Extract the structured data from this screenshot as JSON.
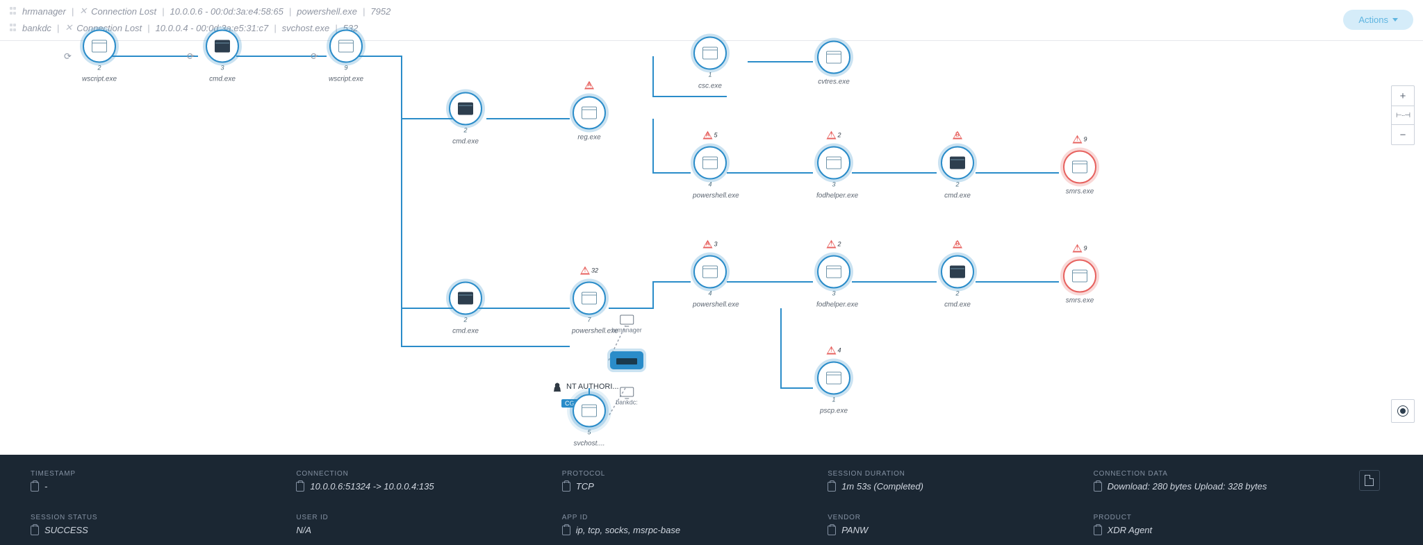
{
  "breadcrumbs": [
    {
      "host": "hrmanager",
      "status": "Connection Lost",
      "detail": "10.0.0.6 - 00:0d:3a:e4:58:65",
      "proc": "powershell.exe",
      "pid": "7952"
    },
    {
      "host": "bankdc",
      "status": "Connection Lost",
      "detail": "10.0.0.4 - 00:0d:3a:e5:31:c7",
      "proc": "svchost.exe",
      "pid": "532"
    }
  ],
  "actions_label": "Actions",
  "nodes": {
    "wscript1": {
      "label": "wscript.exe",
      "count": "2"
    },
    "cmd_top": {
      "label": "cmd.exe",
      "count": "3"
    },
    "wscript2": {
      "label": "wscript.exe",
      "count": "9"
    },
    "cmd_mid": {
      "label": "cmd.exe",
      "count": "2"
    },
    "reg": {
      "label": "reg.exe",
      "count": "",
      "warn": "A",
      "warn_n": ""
    },
    "csc": {
      "label": "csc.exe",
      "count": "1"
    },
    "cvtres": {
      "label": "cvtres.exe",
      "count": ""
    },
    "ps1": {
      "label": "powershell.exe",
      "count": "4",
      "warn": "A",
      "warn_n": "5"
    },
    "fod1": {
      "label": "fodhelper.exe",
      "count": "3",
      "warn": "!",
      "warn_n": "2"
    },
    "cmd_r1": {
      "label": "cmd.exe",
      "count": "2",
      "warn": "B",
      "warn_n": ""
    },
    "smrs1": {
      "label": "smrs.exe",
      "count": "",
      "warn": "!",
      "warn_n": "9"
    },
    "ps2": {
      "label": "powershell.exe",
      "count": "4",
      "warn": "A",
      "warn_n": "3"
    },
    "fod2": {
      "label": "fodhelper.exe",
      "count": "3",
      "warn": "!",
      "warn_n": "2"
    },
    "cmd_r2": {
      "label": "cmd.exe",
      "count": "2",
      "warn": "B",
      "warn_n": ""
    },
    "smrs2": {
      "label": "smrs.exe",
      "count": "",
      "warn": "!",
      "warn_n": "9"
    },
    "cmd_low": {
      "label": "cmd.exe",
      "count": "2"
    },
    "ps3": {
      "label": "powershell.exe",
      "count": "7",
      "warn": "!",
      "warn_n": "32"
    },
    "svchost": {
      "label": "svchost....",
      "count": "5"
    },
    "pscp": {
      "label": "pscp.exe",
      "count": "1",
      "warn": "!",
      "warn_n": "4"
    }
  },
  "mini": {
    "hrmanager": "hrmanager",
    "bankdc": "bankdc:"
  },
  "user_label": "NT AUTHORI...",
  "tag": "CGO",
  "bottom": {
    "timestamp_lab": "TIMESTAMP",
    "timestamp": "-",
    "connection_lab": "CONNECTION",
    "connection": "10.0.0.6:51324 -> 10.0.0.4:135",
    "protocol_lab": "PROTOCOL",
    "protocol": "TCP",
    "duration_lab": "SESSION DURATION",
    "duration": "1m 53s (Completed)",
    "conndata_lab": "CONNECTION DATA",
    "conndata": "Download: 280 bytes Upload: 328 bytes",
    "status_lab": "SESSION STATUS",
    "status": "SUCCESS",
    "user_lab": "USER ID",
    "user": "N/A",
    "appid_lab": "APP ID",
    "appid": "ip, tcp, socks, msrpc-base",
    "vendor_lab": "VENDOR",
    "vendor": "PANW",
    "product_lab": "PRODUCT",
    "product": "XDR Agent"
  }
}
